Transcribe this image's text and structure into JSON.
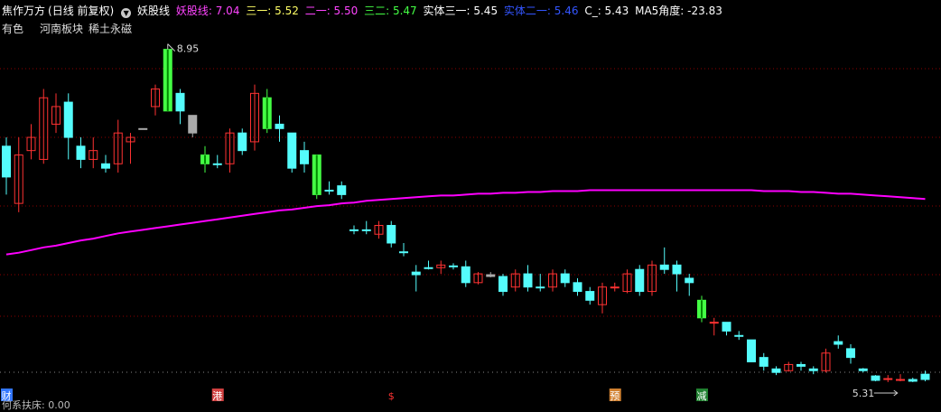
{
  "header": {
    "stock_name": "焦作万方",
    "period": "(日线 前复权)",
    "indicator_icon": "circle-chevron-down-icon",
    "indicator_name": "妖股线",
    "values": [
      {
        "label": "妖股线: 7.04",
        "color": "#ff44ff"
      },
      {
        "label": "三一: 5.52",
        "color": "#ffff66"
      },
      {
        "label": "二一: 5.50",
        "color": "#ff44ff"
      },
      {
        "label": "三二: 5.47",
        "color": "#44ff44"
      },
      {
        "label": "实体三一: 5.45",
        "color": "#ffffff"
      },
      {
        "label": "实体二一: 5.46",
        "color": "#3355ff"
      },
      {
        "label": "C_: 5.43",
        "color": "#ffffff"
      },
      {
        "label": "MA5角度: -23.83",
        "color": "#ffffff"
      }
    ]
  },
  "sub": {
    "sector": "有色",
    "concept1": "河南板块",
    "concept2": "稀土永磁"
  },
  "footer": {
    "text": "何系扶床: 0.00"
  },
  "colors": {
    "up": "#ff3232",
    "down": "#54fcfc",
    "neutral": "#aaaaaa",
    "limit": "#44ff44",
    "ma": "#ff00ff",
    "grid": "#8b0000"
  },
  "chart_data": {
    "type": "candlestick",
    "x_unit": "trading day",
    "y_unit": "price",
    "ylim": [
      5.2,
      9.1
    ],
    "high_annotation": "8.95",
    "low_annotation": "5.31",
    "candles": [
      {
        "o": 7.5,
        "c": 7.85,
        "h": 7.95,
        "l": 7.3,
        "t": "down"
      },
      {
        "o": 7.2,
        "c": 7.75,
        "h": 7.95,
        "l": 7.1,
        "t": "up"
      },
      {
        "o": 7.8,
        "c": 7.95,
        "h": 8.1,
        "l": 7.7,
        "t": "up"
      },
      {
        "o": 7.7,
        "c": 8.4,
        "h": 8.5,
        "l": 7.65,
        "t": "up"
      },
      {
        "o": 8.1,
        "c": 8.3,
        "h": 8.45,
        "l": 8.0,
        "t": "up"
      },
      {
        "o": 8.35,
        "c": 7.95,
        "h": 8.45,
        "l": 7.7,
        "t": "down"
      },
      {
        "o": 7.85,
        "c": 7.7,
        "h": 7.95,
        "l": 7.6,
        "t": "down"
      },
      {
        "o": 7.7,
        "c": 7.8,
        "h": 7.95,
        "l": 7.6,
        "t": "up"
      },
      {
        "o": 7.65,
        "c": 7.6,
        "h": 7.75,
        "l": 7.55,
        "t": "down"
      },
      {
        "o": 7.65,
        "c": 8.0,
        "h": 8.15,
        "l": 7.55,
        "t": "up"
      },
      {
        "o": 7.9,
        "c": 7.95,
        "h": 8.0,
        "l": 7.65,
        "t": "up"
      },
      {
        "o": 8.05,
        "c": 8.05,
        "h": 8.05,
        "l": 8.05,
        "t": "neutral"
      },
      {
        "o": 8.3,
        "c": 8.5,
        "h": 8.55,
        "l": 8.2,
        "t": "up"
      },
      {
        "o": 8.95,
        "c": 8.25,
        "h": 8.95,
        "l": 8.25,
        "t": "limit"
      },
      {
        "o": 8.45,
        "c": 8.25,
        "h": 8.5,
        "l": 8.1,
        "t": "down"
      },
      {
        "o": 8.2,
        "c": 8.0,
        "h": 8.2,
        "l": 7.95,
        "t": "neutral"
      },
      {
        "o": 7.75,
        "c": 7.65,
        "h": 7.85,
        "l": 7.55,
        "t": "limit"
      },
      {
        "o": 7.65,
        "c": 7.65,
        "h": 7.75,
        "l": 7.6,
        "t": "down"
      },
      {
        "o": 7.65,
        "c": 8.0,
        "h": 8.05,
        "l": 7.55,
        "t": "up"
      },
      {
        "o": 8.0,
        "c": 7.8,
        "h": 8.05,
        "l": 7.75,
        "t": "down"
      },
      {
        "o": 7.9,
        "c": 8.45,
        "h": 8.55,
        "l": 7.8,
        "t": "up"
      },
      {
        "o": 8.4,
        "c": 8.05,
        "h": 8.5,
        "l": 8.0,
        "t": "limit"
      },
      {
        "o": 8.05,
        "c": 8.1,
        "h": 8.2,
        "l": 7.9,
        "t": "down"
      },
      {
        "o": 8.0,
        "c": 7.6,
        "h": 8.0,
        "l": 7.55,
        "t": "down"
      },
      {
        "o": 7.8,
        "c": 7.65,
        "h": 7.9,
        "l": 7.55,
        "t": "down"
      },
      {
        "o": 7.75,
        "c": 7.3,
        "h": 7.75,
        "l": 7.25,
        "t": "limit"
      },
      {
        "o": 7.35,
        "c": 7.35,
        "h": 7.45,
        "l": 7.3,
        "t": "down"
      },
      {
        "o": 7.4,
        "c": 7.3,
        "h": 7.45,
        "l": 7.25,
        "t": "down"
      },
      {
        "o": 6.9,
        "c": 6.9,
        "h": 6.95,
        "l": 6.85,
        "t": "down"
      },
      {
        "o": 6.9,
        "c": 6.9,
        "h": 7.0,
        "l": 6.85,
        "t": "down"
      },
      {
        "o": 6.85,
        "c": 6.95,
        "h": 7.0,
        "l": 6.8,
        "t": "up"
      },
      {
        "o": 6.95,
        "c": 6.75,
        "h": 7.0,
        "l": 6.7,
        "t": "down"
      },
      {
        "o": 6.65,
        "c": 6.65,
        "h": 6.75,
        "l": 6.6,
        "t": "down"
      },
      {
        "o": 6.42,
        "c": 6.39,
        "h": 6.5,
        "l": 6.2,
        "t": "down"
      },
      {
        "o": 6.47,
        "c": 6.47,
        "h": 6.55,
        "l": 6.45,
        "t": "down"
      },
      {
        "o": 6.47,
        "c": 6.5,
        "h": 6.55,
        "l": 6.4,
        "t": "up"
      },
      {
        "o": 6.49,
        "c": 6.48,
        "h": 6.52,
        "l": 6.45,
        "t": "down"
      },
      {
        "o": 6.48,
        "c": 6.3,
        "h": 6.55,
        "l": 6.25,
        "t": "down"
      },
      {
        "o": 6.3,
        "c": 6.4,
        "h": 6.42,
        "l": 6.28,
        "t": "up"
      },
      {
        "o": 6.39,
        "c": 6.37,
        "h": 6.42,
        "l": 6.36,
        "t": "neutral"
      },
      {
        "o": 6.37,
        "c": 6.2,
        "h": 6.4,
        "l": 6.15,
        "t": "down"
      },
      {
        "o": 6.25,
        "c": 6.4,
        "h": 6.45,
        "l": 6.2,
        "t": "up"
      },
      {
        "o": 6.4,
        "c": 6.25,
        "h": 6.5,
        "l": 6.2,
        "t": "down"
      },
      {
        "o": 6.25,
        "c": 6.25,
        "h": 6.4,
        "l": 6.2,
        "t": "down"
      },
      {
        "o": 6.25,
        "c": 6.4,
        "h": 6.45,
        "l": 6.2,
        "t": "up"
      },
      {
        "o": 6.4,
        "c": 6.3,
        "h": 6.45,
        "l": 6.25,
        "t": "down"
      },
      {
        "o": 6.3,
        "c": 6.2,
        "h": 6.35,
        "l": 6.15,
        "t": "down"
      },
      {
        "o": 6.2,
        "c": 6.1,
        "h": 6.25,
        "l": 6.05,
        "t": "down"
      },
      {
        "o": 6.05,
        "c": 6.25,
        "h": 6.3,
        "l": 5.95,
        "t": "up"
      },
      {
        "o": 6.25,
        "c": 6.25,
        "h": 6.3,
        "l": 6.2,
        "t": "up"
      },
      {
        "o": 6.2,
        "c": 6.4,
        "h": 6.45,
        "l": 6.18,
        "t": "up"
      },
      {
        "o": 6.45,
        "c": 6.2,
        "h": 6.5,
        "l": 6.15,
        "t": "down"
      },
      {
        "o": 6.2,
        "c": 6.5,
        "h": 6.55,
        "l": 6.15,
        "t": "up"
      },
      {
        "o": 6.5,
        "c": 6.45,
        "h": 6.7,
        "l": 6.4,
        "t": "down"
      },
      {
        "o": 6.5,
        "c": 6.4,
        "h": 6.55,
        "l": 6.2,
        "t": "down"
      },
      {
        "o": 6.35,
        "c": 6.3,
        "h": 6.4,
        "l": 6.15,
        "t": "down"
      },
      {
        "o": 6.1,
        "c": 5.9,
        "h": 6.15,
        "l": 5.85,
        "t": "limit"
      },
      {
        "o": 5.85,
        "c": 5.85,
        "h": 5.9,
        "l": 5.7,
        "t": "up"
      },
      {
        "o": 5.85,
        "c": 5.75,
        "h": 5.85,
        "l": 5.7,
        "t": "down"
      },
      {
        "o": 5.7,
        "c": 5.7,
        "h": 5.75,
        "l": 5.65,
        "t": "down"
      },
      {
        "o": 5.65,
        "c": 5.4,
        "h": 5.65,
        "l": 5.4,
        "t": "down"
      },
      {
        "o": 5.45,
        "c": 5.35,
        "h": 5.5,
        "l": 5.3,
        "t": "down"
      },
      {
        "o": 5.32,
        "c": 5.28,
        "h": 5.35,
        "l": 5.25,
        "t": "down"
      },
      {
        "o": 5.3,
        "c": 5.37,
        "h": 5.4,
        "l": 5.29,
        "t": "up"
      },
      {
        "o": 5.37,
        "c": 5.35,
        "h": 5.4,
        "l": 5.3,
        "t": "down"
      },
      {
        "o": 5.3,
        "c": 5.32,
        "h": 5.35,
        "l": 5.26,
        "t": "down"
      },
      {
        "o": 5.3,
        "c": 5.5,
        "h": 5.55,
        "l": 5.28,
        "t": "up"
      },
      {
        "o": 5.6,
        "c": 5.63,
        "h": 5.7,
        "l": 5.55,
        "t": "down"
      },
      {
        "o": 5.55,
        "c": 5.45,
        "h": 5.6,
        "l": 5.38,
        "t": "down"
      },
      {
        "o": 5.3,
        "c": 5.32,
        "h": 5.33,
        "l": 5.28,
        "t": "down"
      },
      {
        "o": 5.24,
        "c": 5.19,
        "h": 5.25,
        "l": 5.18,
        "t": "down"
      },
      {
        "o": 5.2,
        "c": 5.21,
        "h": 5.25,
        "l": 5.17,
        "t": "up"
      },
      {
        "o": 5.2,
        "c": 5.2,
        "h": 5.26,
        "l": 5.18,
        "t": "up"
      },
      {
        "o": 5.18,
        "c": 5.2,
        "h": 5.22,
        "l": 5.17,
        "t": "down"
      },
      {
        "o": 5.2,
        "c": 5.26,
        "h": 5.3,
        "l": 5.18,
        "t": "down"
      }
    ],
    "ma_line": [
      6.62,
      6.64,
      6.67,
      6.7,
      6.72,
      6.75,
      6.78,
      6.8,
      6.83,
      6.86,
      6.88,
      6.9,
      6.92,
      6.94,
      6.96,
      6.98,
      7.0,
      7.02,
      7.04,
      7.06,
      7.08,
      7.1,
      7.12,
      7.13,
      7.15,
      7.17,
      7.18,
      7.2,
      7.21,
      7.23,
      7.24,
      7.25,
      7.26,
      7.27,
      7.28,
      7.29,
      7.29,
      7.3,
      7.31,
      7.31,
      7.32,
      7.32,
      7.33,
      7.33,
      7.34,
      7.34,
      7.34,
      7.35,
      7.35,
      7.35,
      7.35,
      7.35,
      7.35,
      7.35,
      7.35,
      7.35,
      7.35,
      7.35,
      7.35,
      7.35,
      7.35,
      7.34,
      7.34,
      7.34,
      7.33,
      7.33,
      7.32,
      7.31,
      7.31,
      7.3,
      7.29,
      7.28,
      7.27,
      7.26,
      7.25
    ],
    "markers": [
      {
        "index": 0,
        "label": "财",
        "color": "#3377ff",
        "text_color": "#ffffff"
      },
      {
        "index": 17,
        "label": "港",
        "color": "#d04040",
        "text_color": "#ffffff"
      },
      {
        "index": 31,
        "label": "$",
        "color": "#000000",
        "text_color": "#ff3333"
      },
      {
        "index": 49,
        "label": "预",
        "color": "#d08030",
        "text_color": "#ffffff"
      },
      {
        "index": 56,
        "label": "减",
        "color": "#208030",
        "text_color": "#ffffff"
      }
    ]
  }
}
